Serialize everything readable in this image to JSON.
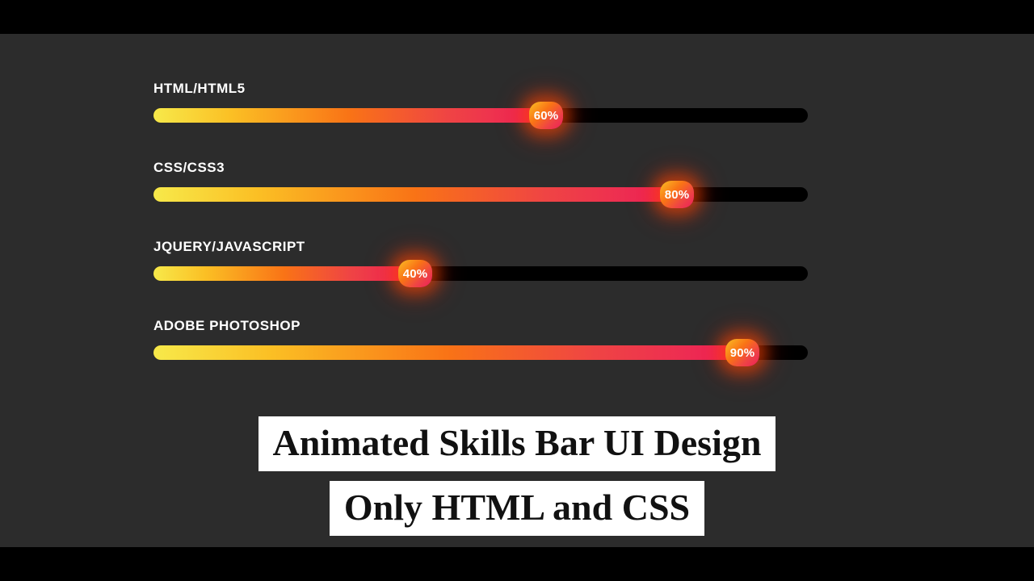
{
  "chart_data": {
    "type": "bar",
    "categories": [
      "HTML/HTML5",
      "CSS/CSS3",
      "JQUERY/JAVASCRIPT",
      "ADOBE PHOTOSHOP"
    ],
    "values": [
      60,
      80,
      40,
      90
    ],
    "title": "Animated Skills Bar UI Design",
    "xlabel": "",
    "ylabel": "",
    "ylim": [
      0,
      100
    ]
  },
  "skills": [
    {
      "label": "HTML/HTML5",
      "percent": 60,
      "percent_text": "60%"
    },
    {
      "label": "CSS/CSS3",
      "percent": 80,
      "percent_text": "80%"
    },
    {
      "label": "JQUERY/JAVASCRIPT",
      "percent": 40,
      "percent_text": "40%"
    },
    {
      "label": "ADOBE PHOTOSHOP",
      "percent": 90,
      "percent_text": "90%"
    }
  ],
  "caption": {
    "line1": "Animated Skills Bar UI Design",
    "line2": "Only HTML and CSS"
  },
  "colors": {
    "page_bg": "#000000",
    "stage_bg": "#2c2c2c",
    "track_bg": "#000000",
    "gradient_start": "#f7e94a",
    "gradient_end": "#ec1e5a",
    "caption_bg": "#ffffff",
    "caption_fg": "#111111"
  }
}
